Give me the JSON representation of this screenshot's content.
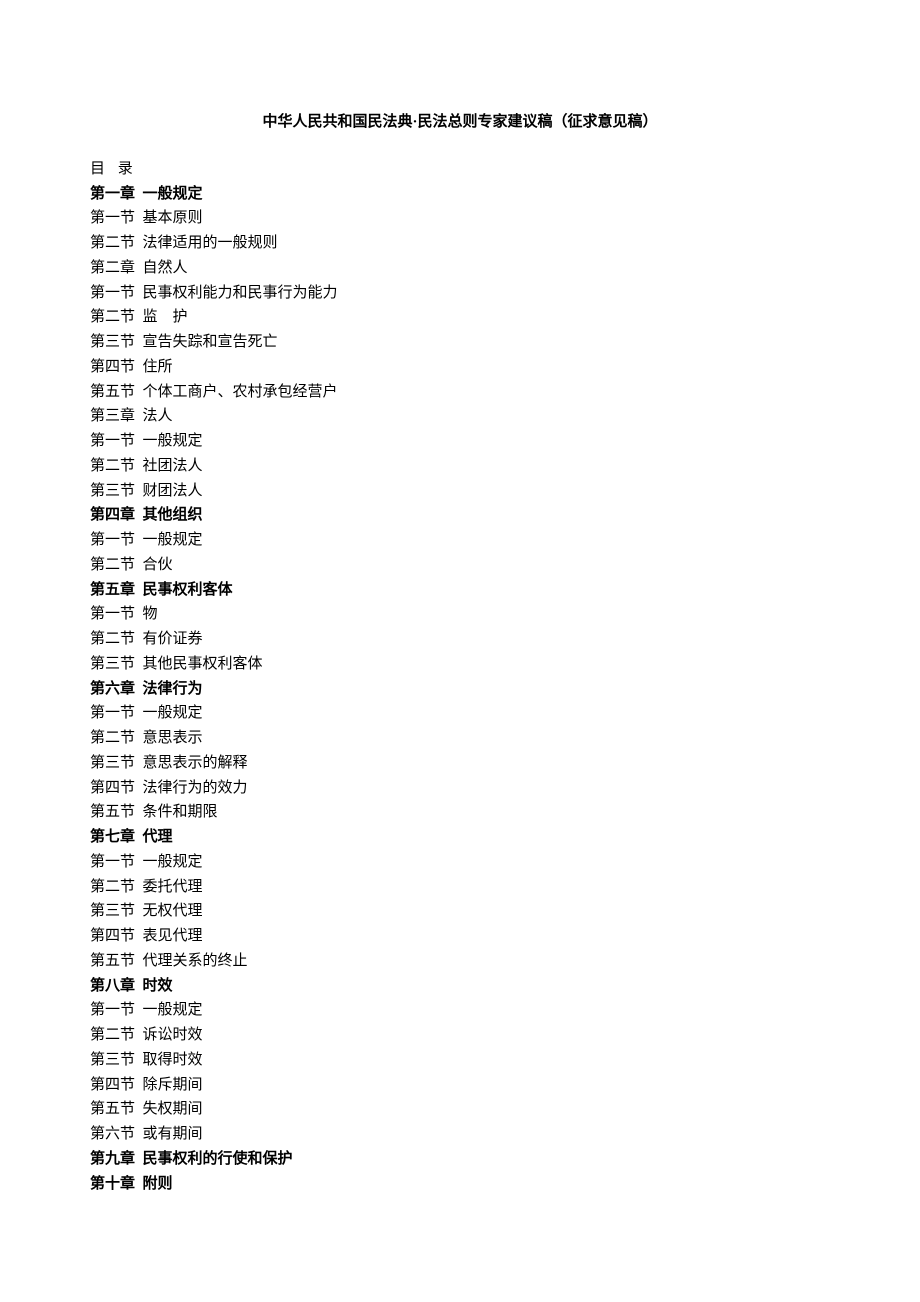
{
  "title": "中华人民共和国民法典·民法总则专家建议稿（征求意见稿）",
  "tocLabel": "目 录",
  "items": [
    {
      "text": "第一章  一般规定",
      "bold": true
    },
    {
      "text": "第一节  基本原则",
      "bold": false
    },
    {
      "text": "第二节  法律适用的一般规则",
      "bold": false
    },
    {
      "text": "第二章  自然人",
      "bold": false
    },
    {
      "text": "第一节  民事权利能力和民事行为能力",
      "bold": false
    },
    {
      "text": "第二节  监    护",
      "bold": false
    },
    {
      "text": "第三节  宣告失踪和宣告死亡",
      "bold": false
    },
    {
      "text": "第四节  住所",
      "bold": false
    },
    {
      "text": "第五节  个体工商户、农村承包经营户",
      "bold": false
    },
    {
      "text": "第三章  法人",
      "bold": false
    },
    {
      "text": "第一节  一般规定",
      "bold": false
    },
    {
      "text": "第二节  社团法人",
      "bold": false
    },
    {
      "text": "第三节  财团法人",
      "bold": false
    },
    {
      "text": "第四章  其他组织",
      "bold": true
    },
    {
      "text": "第一节  一般规定",
      "bold": false
    },
    {
      "text": "第二节  合伙",
      "bold": false
    },
    {
      "text": "第五章  民事权利客体",
      "bold": true
    },
    {
      "text": "第一节  物",
      "bold": false
    },
    {
      "text": "第二节  有价证券",
      "bold": false
    },
    {
      "text": "第三节  其他民事权利客体",
      "bold": false
    },
    {
      "text": "第六章  法律行为",
      "bold": true
    },
    {
      "text": "第一节  一般规定",
      "bold": false
    },
    {
      "text": "第二节  意思表示",
      "bold": false
    },
    {
      "text": "第三节  意思表示的解释",
      "bold": false
    },
    {
      "text": "第四节  法律行为的效力",
      "bold": false
    },
    {
      "text": "第五节  条件和期限",
      "bold": false
    },
    {
      "text": "第七章  代理",
      "bold": true
    },
    {
      "text": "第一节  一般规定",
      "bold": false
    },
    {
      "text": "第二节  委托代理",
      "bold": false
    },
    {
      "text": "第三节  无权代理",
      "bold": false
    },
    {
      "text": "第四节  表见代理",
      "bold": false
    },
    {
      "text": "第五节  代理关系的终止",
      "bold": false
    },
    {
      "text": "第八章  时效",
      "bold": true
    },
    {
      "text": "第一节  一般规定",
      "bold": false
    },
    {
      "text": "第二节  诉讼时效",
      "bold": false
    },
    {
      "text": "第三节  取得时效",
      "bold": false
    },
    {
      "text": "第四节  除斥期间",
      "bold": false
    },
    {
      "text": "第五节  失权期间",
      "bold": false
    },
    {
      "text": "第六节  或有期间",
      "bold": false
    },
    {
      "text": "第九章  民事权利的行使和保护",
      "bold": true
    },
    {
      "text": "第十章  附则",
      "bold": true
    }
  ]
}
